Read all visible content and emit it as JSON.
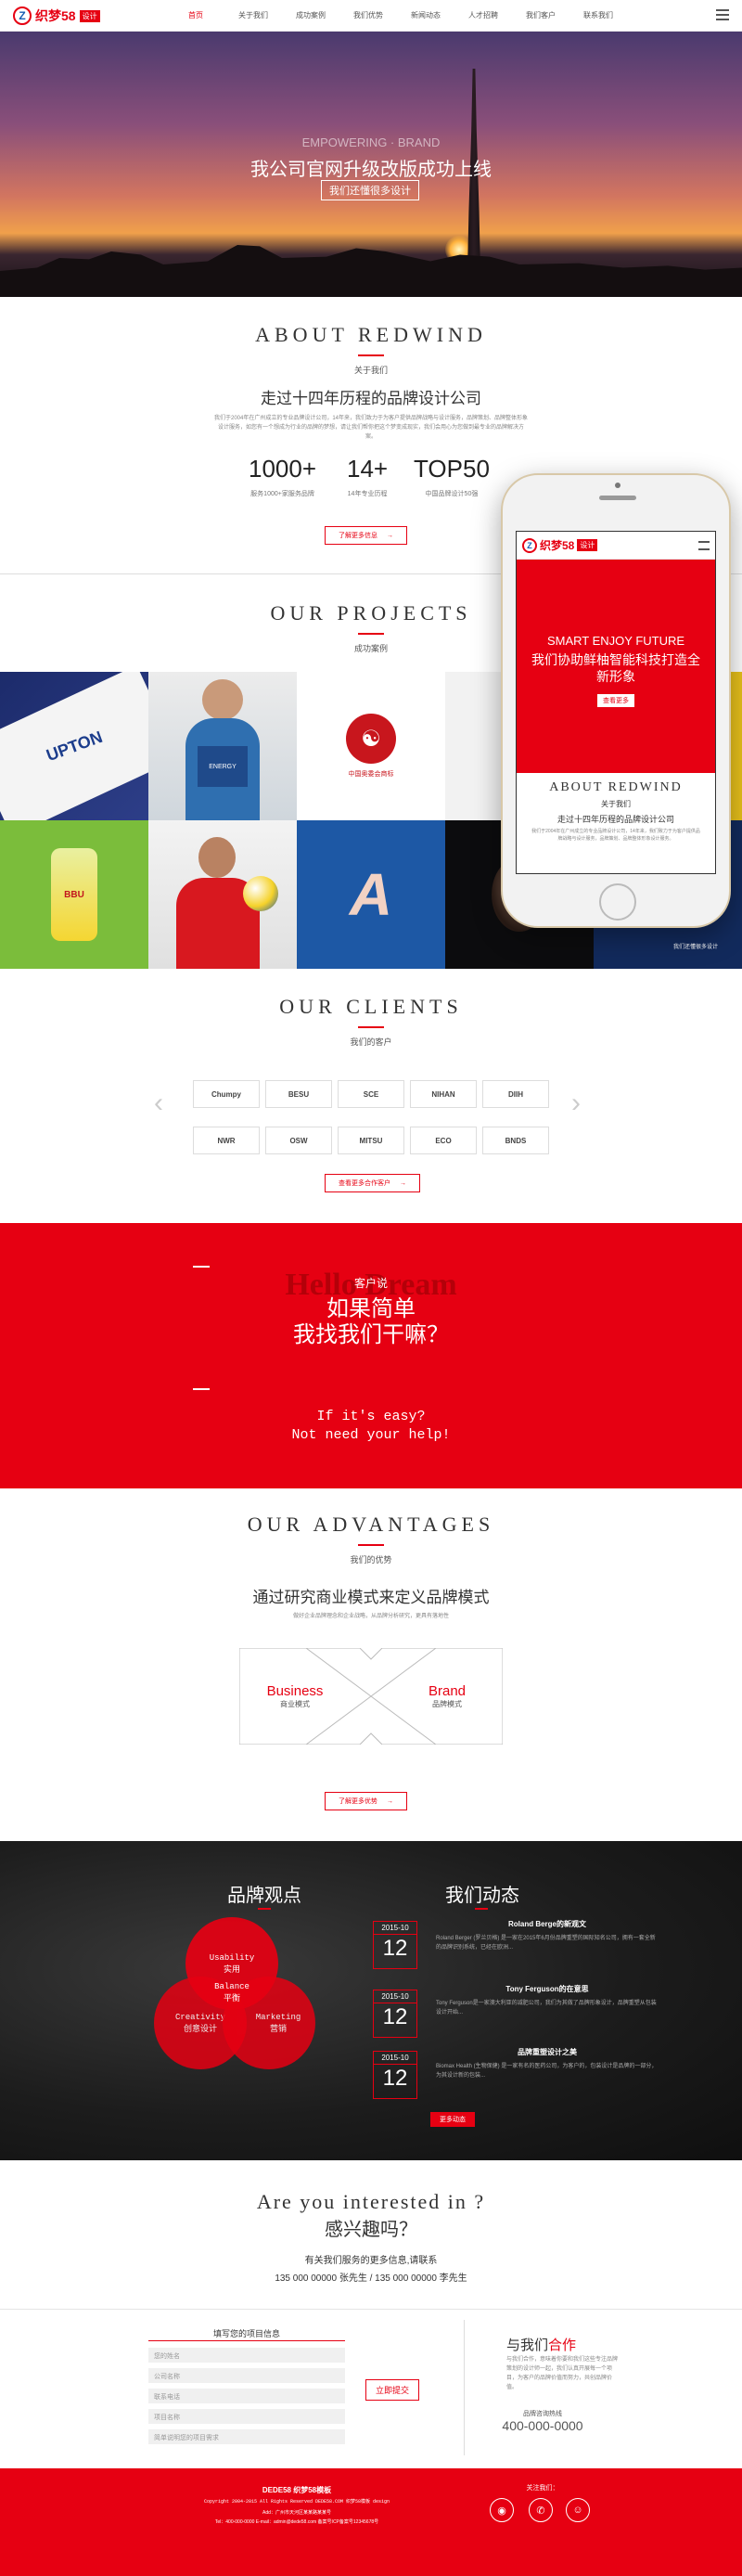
{
  "header": {
    "logo_mark": "Z",
    "logo_text": "织梦58",
    "logo_tag": "设计",
    "nav": [
      "首页",
      "关于我们",
      "成功案例",
      "我们优势",
      "新闻动态",
      "人才招聘",
      "我们客户",
      "联系我们"
    ]
  },
  "hero": {
    "subtitle": "EMPOWERING · BRAND",
    "title": "我公司官网升级改版成功上线",
    "box": "我们还懂很多设计"
  },
  "about": {
    "title_en": "ABOUT REDWIND",
    "title_zh": "关于我们",
    "headline": "走过十四年历程的品牌设计公司",
    "desc": "我们于2004年在广州成立的专业品牌设计公司，14年来，我们致力于为客户提供品牌战略与设计服务，品牌策划、品牌整体形象设计服务，如您有一个想成为行业的品牌的梦想，请让我们帮你把这个梦变成现实，我们会用心为您做到最专业的品牌解决方案。",
    "stats": [
      {
        "value": "1000+",
        "label": "服务1000+家服务品牌"
      },
      {
        "value": "14+",
        "label": "14年专业历程"
      },
      {
        "value": "TOP50",
        "label": "中国品牌设计50强"
      }
    ],
    "more": "了解更多信息"
  },
  "projects": {
    "title_en": "OUR PROJECTS",
    "title_zh": "成功案例",
    "items": [
      {
        "label": "UPTON"
      },
      {
        "label": "ENERGY"
      },
      {
        "label": "中国奥委会商标"
      },
      {
        "label": "C"
      },
      {
        "label": ""
      },
      {
        "label": "BBU"
      },
      {
        "label": ""
      },
      {
        "label": "A"
      },
      {
        "label": ""
      },
      {
        "label": "我们还懂很多设计"
      }
    ]
  },
  "phone": {
    "logo_text": "织梦58",
    "logo_tag": "设计",
    "banner_en": "SMART ENJOY FUTURE",
    "banner_zh": "我们协助鲜柚智能科技打造全新形象",
    "banner_btn": "查看更多",
    "about_en": "ABOUT REDWIND",
    "about_zh": "关于我们",
    "about_headline": "走过十四年历程的品牌设计公司",
    "about_desc": "我们于2004年在广州成立的专业品牌设计公司，14年来，我们致力于为客户提供品牌战略与设计服务，品牌策划、品牌整体形象设计服务。"
  },
  "clients": {
    "title_en": "OUR CLIENTS",
    "title_zh": "我们的客户",
    "logos": [
      "Chumpy",
      "BESU",
      "SCE",
      "NIHAN",
      "DIIH",
      "NWR",
      "OSW",
      "MITSU",
      "ECO",
      "BNDS"
    ],
    "more": "查看更多合作客户"
  },
  "cta": {
    "small": "客户说",
    "watermark": "Hello Dream",
    "line1": "如果简单",
    "line2": "我找我们干嘛？",
    "en1": "If it's easy?",
    "en2": "Not need your help!"
  },
  "advantages": {
    "title_en": "OUR ADVANTAGES",
    "title_zh": "我们的优势",
    "headline": "通过研究商业模式来定义品牌模式",
    "desc": "做好企业品牌理念和企业战略，从品牌分析研究，更具有落地性",
    "left_en": "Business",
    "left_zh": "商业模式",
    "right_en": "Brand",
    "right_zh": "品牌模式",
    "more": "了解更多优势"
  },
  "brand": {
    "title": "品牌观点",
    "circles": [
      {
        "en": "Usability",
        "zh": "实用"
      },
      {
        "en": "Balance",
        "zh": "平衡"
      },
      {
        "en": "Creativity",
        "zh": "创意设计"
      },
      {
        "en": "Marketing",
        "zh": "营销"
      }
    ]
  },
  "news": {
    "title": "我们动态",
    "items": [
      {
        "ym": "2015-10",
        "day": "12",
        "title": "Roland Berge的新观文",
        "desc": "Roland Berger (罗兰贝格) 是一家在2015年6月份品牌重塑的国际知名公司，拥有一套全新的品牌识别系统，已经在欧洲..."
      },
      {
        "ym": "2015-10",
        "day": "12",
        "title": "Tony Ferguson的在意思",
        "desc": "Tony Ferguson是一家澳大利亚的减肥公司，我们为其做了品牌形象设计，品牌重塑从包装设计开始..."
      },
      {
        "ym": "2015-10",
        "day": "12",
        "title": "品牌重塑设计之美",
        "desc": "Biomax Health (生物保健) 是一家有名的医药公司，为客户的，包装设计是品牌的一部分，为其设计新的包装..."
      }
    ],
    "more": "更多动态"
  },
  "interest": {
    "en": "Are you interested in ?",
    "zh": "感兴趣吗？",
    "desc": "有关我们服务的更多信息,请联系",
    "phones": "135 000 00000 张先生 / 135 000 00000 李先生"
  },
  "form": {
    "title": "填写您的项目信息",
    "fields": [
      "您的姓名",
      "公司名称",
      "联系电话",
      "项目名称",
      "简单说明您的项目需求"
    ],
    "submit": "立即提交"
  },
  "cooperate": {
    "title_a": "与我们",
    "title_b": "合作",
    "desc": "与我们合作，意味着你要和我们这些专注品牌策划的设计师一起，我们认真开展每一个项目，为客户的品牌价值而努力，共创品牌价值。",
    "hotline_label": "品牌咨询热线",
    "hotline": "400-000-0000"
  },
  "footer": {
    "line1": "DEDE58 织梦58模板",
    "line2": "Copyright 2004-2015 All Rights Reserved DEDE58.COM 织梦58模板 design",
    "line3": "Add：广州市天河区某某路某某号",
    "line4": "Tel：400-000-0000   E-mail：admin@dede58.com   备案号ICP备案号12345678号",
    "follow": "关注我们：",
    "icons": [
      "weibo-icon",
      "wechat-icon",
      "qq-icon"
    ]
  }
}
